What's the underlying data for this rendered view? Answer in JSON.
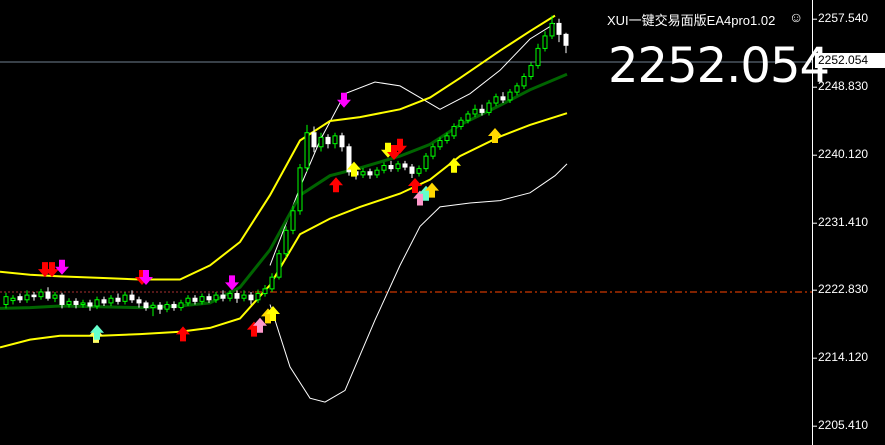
{
  "chart_data": {
    "type": "candlestick",
    "title": "XUI一键交易面版EA4pro1.02",
    "current_price": "2252.054",
    "current_price_tag": "2252.054",
    "y_ticks": [
      "2257.540",
      "2248.830",
      "2240.120",
      "2231.410",
      "2222.830",
      "2214.120",
      "2205.410"
    ],
    "ylim": [
      2203.0,
      2260.0
    ],
    "reference_level": 2222.6,
    "colors": {
      "background": "#000000",
      "bull_candle": "#00ff00",
      "bear_candle": "#ffffff",
      "outer_band": "#ffff00",
      "middle_line": "#006400",
      "envelope": "#ffffff",
      "reference_line": "#ff4500",
      "current_price_line": "#708090"
    },
    "upper_band": [
      [
        0,
        2225.2
      ],
      [
        30,
        2224.8
      ],
      [
        60,
        2224.6
      ],
      [
        100,
        2224.4
      ],
      [
        140,
        2224.2
      ],
      [
        180,
        2224.2
      ],
      [
        210,
        2226
      ],
      [
        240,
        2229
      ],
      [
        270,
        2235
      ],
      [
        300,
        2242
      ],
      [
        330,
        2244.5
      ],
      [
        360,
        2245
      ],
      [
        400,
        2246
      ],
      [
        430,
        2247.5
      ],
      [
        460,
        2250
      ],
      [
        500,
        2253.5
      ],
      [
        530,
        2256
      ],
      [
        555,
        2258
      ]
    ],
    "lower_band": [
      [
        0,
        2215.5
      ],
      [
        30,
        2216.5
      ],
      [
        60,
        2217
      ],
      [
        100,
        2217
      ],
      [
        140,
        2217.2
      ],
      [
        180,
        2217.5
      ],
      [
        210,
        2218
      ],
      [
        240,
        2219.2
      ],
      [
        270,
        2223.5
      ],
      [
        300,
        2230
      ],
      [
        330,
        2232
      ],
      [
        360,
        2233.5
      ],
      [
        400,
        2235.2
      ],
      [
        430,
        2237
      ],
      [
        460,
        2240
      ],
      [
        500,
        2242.5
      ],
      [
        530,
        2244
      ],
      [
        567,
        2245.5
      ]
    ],
    "middle_line": [
      [
        0,
        2220.5
      ],
      [
        30,
        2220.6
      ],
      [
        60,
        2220.8
      ],
      [
        100,
        2220.7
      ],
      [
        140,
        2220.6
      ],
      [
        180,
        2220.8
      ],
      [
        210,
        2221.2
      ],
      [
        240,
        2223.2
      ],
      [
        270,
        2228
      ],
      [
        300,
        2235
      ],
      [
        330,
        2237.5
      ],
      [
        360,
        2238.5
      ],
      [
        400,
        2240
      ],
      [
        430,
        2241.5
      ],
      [
        460,
        2244
      ],
      [
        500,
        2246.5
      ],
      [
        530,
        2248.5
      ],
      [
        567,
        2250.5
      ]
    ],
    "envelope_upper": [
      [
        270,
        2226
      ],
      [
        300,
        2236
      ],
      [
        320,
        2242
      ],
      [
        345,
        2248
      ],
      [
        375,
        2249.5
      ],
      [
        400,
        2249
      ],
      [
        420,
        2247.5
      ],
      [
        440,
        2246
      ],
      [
        470,
        2248
      ],
      [
        500,
        2251
      ],
      [
        530,
        2255
      ],
      [
        555,
        2257
      ]
    ],
    "envelope_lower": [
      [
        270,
        2221
      ],
      [
        290,
        2213
      ],
      [
        310,
        2209
      ],
      [
        325,
        2208.5
      ],
      [
        345,
        2210
      ],
      [
        375,
        2219
      ],
      [
        400,
        2226
      ],
      [
        420,
        2231
      ],
      [
        440,
        2233.5
      ],
      [
        470,
        2234
      ],
      [
        500,
        2234.3
      ],
      [
        530,
        2235.3
      ],
      [
        555,
        2237.5
      ],
      [
        567,
        2239
      ]
    ],
    "candles": [
      [
        6,
        2221,
        2222,
        2220.5,
        2222.5
      ],
      [
        13,
        2221.5,
        2221.8,
        2221,
        2222.2
      ],
      [
        20,
        2222,
        2221.6,
        2221.2,
        2222.4
      ],
      [
        27,
        2221.6,
        2222.2,
        2221.2,
        2222.8
      ],
      [
        34,
        2222.2,
        2222,
        2221.5,
        2222.6
      ],
      [
        41,
        2222,
        2222.6,
        2221.6,
        2223
      ],
      [
        48,
        2222.6,
        2221.8,
        2221.5,
        2223.2
      ],
      [
        55,
        2221.8,
        2222.2,
        2221.3,
        2222.6
      ],
      [
        62,
        2222.2,
        2221,
        2220.5,
        2222.5
      ],
      [
        69,
        2221,
        2221.4,
        2220.6,
        2221.8
      ],
      [
        76,
        2221.4,
        2221,
        2220.5,
        2221.8
      ],
      [
        83,
        2221,
        2221.2,
        2220.6,
        2221.6
      ],
      [
        90,
        2221.2,
        2220.8,
        2220.2,
        2221.6
      ],
      [
        97,
        2220.8,
        2221.6,
        2220.4,
        2222
      ],
      [
        104,
        2221.6,
        2221.2,
        2220.8,
        2222
      ],
      [
        111,
        2221.2,
        2221.8,
        2220.8,
        2222.2
      ],
      [
        118,
        2221.8,
        2221.4,
        2221,
        2222.4
      ],
      [
        125,
        2221.4,
        2222.2,
        2221,
        2222.6
      ],
      [
        132,
        2222.2,
        2221.6,
        2221.2,
        2222.8
      ],
      [
        139,
        2221.6,
        2221.2,
        2220.6,
        2222
      ],
      [
        146,
        2221.2,
        2220.6,
        2220.2,
        2221.5
      ],
      [
        153,
        2220.6,
        2220.9,
        2219.5,
        2221.3
      ],
      [
        160,
        2220.9,
        2220.4,
        2219.8,
        2221.3
      ],
      [
        167,
        2220.4,
        2221,
        2220,
        2221.4
      ],
      [
        174,
        2221,
        2220.6,
        2220.2,
        2221.4
      ],
      [
        181,
        2220.6,
        2221.2,
        2220.2,
        2221.6
      ],
      [
        188,
        2221.2,
        2221.8,
        2220.8,
        2222.2
      ],
      [
        195,
        2221.8,
        2221.4,
        2221,
        2222.2
      ],
      [
        202,
        2221.4,
        2222,
        2221,
        2222.4
      ],
      [
        209,
        2222,
        2221.6,
        2221.2,
        2222.4
      ],
      [
        216,
        2221.6,
        2222.2,
        2221.2,
        2222.6
      ],
      [
        223,
        2222.2,
        2221.8,
        2221.4,
        2222.8
      ],
      [
        230,
        2221.8,
        2222.4,
        2221.4,
        2222.8
      ],
      [
        237,
        2222.4,
        2221.8,
        2221.2,
        2222.8
      ],
      [
        244,
        2221.8,
        2222.2,
        2221.4,
        2222.8
      ],
      [
        251,
        2222.2,
        2221.6,
        2221,
        2222.6
      ],
      [
        258,
        2221.6,
        2222.4,
        2221.2,
        2222.9
      ],
      [
        265,
        2222.4,
        2223,
        2222,
        2223.5
      ],
      [
        272,
        2223,
        2224.5,
        2222.6,
        2225
      ],
      [
        279,
        2224.5,
        2227.5,
        2224.2,
        2228
      ],
      [
        286,
        2227.5,
        2230.5,
        2227,
        2231
      ],
      [
        293,
        2230.5,
        2233,
        2230,
        2233.6
      ],
      [
        300,
        2233,
        2238.5,
        2232.5,
        2239
      ],
      [
        307,
        2238.5,
        2243,
        2238,
        2244
      ],
      [
        314,
        2243,
        2241.2,
        2240.5,
        2243.8
      ],
      [
        321,
        2241.2,
        2242.4,
        2240.6,
        2243
      ],
      [
        328,
        2242.4,
        2241.6,
        2241,
        2242.8
      ],
      [
        335,
        2241.6,
        2242.6,
        2241,
        2243
      ],
      [
        342,
        2242.6,
        2241.2,
        2240.6,
        2243
      ],
      [
        349,
        2241.2,
        2238,
        2237.5,
        2241.6
      ],
      [
        356,
        2238,
        2237.6,
        2237,
        2238.4
      ],
      [
        363,
        2237.6,
        2238,
        2237.2,
        2238.5
      ],
      [
        370,
        2238,
        2237.6,
        2237.1,
        2238.4
      ],
      [
        377,
        2237.6,
        2238.2,
        2237.2,
        2238.6
      ],
      [
        384,
        2238.2,
        2238.8,
        2237.8,
        2239.2
      ],
      [
        391,
        2238.8,
        2238.4,
        2238,
        2239.4
      ],
      [
        398,
        2238.4,
        2239,
        2238,
        2239.4
      ],
      [
        405,
        2239,
        2238.6,
        2238.2,
        2239.4
      ],
      [
        412,
        2238.6,
        2237.8,
        2237.2,
        2239
      ],
      [
        419,
        2237.8,
        2238.4,
        2237.4,
        2238.8
      ],
      [
        426,
        2238.4,
        2240,
        2238,
        2240.4
      ],
      [
        433,
        2240,
        2241.2,
        2239.6,
        2241.6
      ],
      [
        440,
        2241.2,
        2242,
        2240.8,
        2242.4
      ],
      [
        447,
        2242,
        2242.6,
        2241.6,
        2243
      ],
      [
        454,
        2242.6,
        2243.8,
        2242.2,
        2244.2
      ],
      [
        461,
        2243.8,
        2244.6,
        2243.4,
        2245
      ],
      [
        468,
        2244.6,
        2245.4,
        2244.2,
        2245.8
      ],
      [
        475,
        2245.4,
        2246,
        2245,
        2246.6
      ],
      [
        482,
        2246,
        2245.6,
        2245.2,
        2246.6
      ],
      [
        489,
        2245.6,
        2246.8,
        2245.2,
        2247.2
      ],
      [
        496,
        2246.8,
        2247.6,
        2246.4,
        2248
      ],
      [
        503,
        2247.6,
        2247.2,
        2246.8,
        2248.2
      ],
      [
        510,
        2247.2,
        2248.2,
        2246.8,
        2248.6
      ],
      [
        517,
        2248.2,
        2249,
        2247.8,
        2249.4
      ],
      [
        524,
        2249,
        2250.2,
        2248.6,
        2250.6
      ],
      [
        531,
        2250.2,
        2251.6,
        2249.8,
        2252
      ],
      [
        538,
        2251.6,
        2253.8,
        2251.2,
        2254.4
      ],
      [
        545,
        2253.8,
        2255.4,
        2253.4,
        2256
      ],
      [
        552,
        2255.4,
        2257,
        2255,
        2258
      ],
      [
        559,
        2257,
        2255.6,
        2254.6,
        2257.6
      ],
      [
        566,
        2255.6,
        2254.2,
        2253.2,
        2255.8
      ]
    ],
    "arrows": [
      [
        45,
        2224.5,
        "down",
        "#ff0000"
      ],
      [
        52,
        2224.5,
        "down",
        "#ff0000"
      ],
      [
        62,
        2224.8,
        "down",
        "#ff00ff"
      ],
      [
        96,
        2218,
        "up",
        "#ffff66"
      ],
      [
        97,
        2218.4,
        "up",
        "#66ffcc"
      ],
      [
        142,
        2223.5,
        "down",
        "#ff0000"
      ],
      [
        146,
        2223.5,
        "down",
        "#ff00ff"
      ],
      [
        183,
        2218.2,
        "up",
        "#ff0000"
      ],
      [
        232,
        2222.8,
        "down",
        "#ff00ff"
      ],
      [
        254,
        2218.8,
        "up",
        "#ff0000"
      ],
      [
        260,
        2219.3,
        "up",
        "#ff99cc"
      ],
      [
        268,
        2220.5,
        "up",
        "#ffd700"
      ],
      [
        273,
        2220.8,
        "up",
        "#ffff00"
      ],
      [
        344,
        2246.2,
        "down",
        "#ff00ff"
      ],
      [
        336,
        2237.3,
        "up",
        "#ff0000"
      ],
      [
        354,
        2239.3,
        "up",
        "#ffff00"
      ],
      [
        388,
        2239.8,
        "down",
        "#ffff00"
      ],
      [
        394,
        2239.5,
        "down",
        "#ff0000"
      ],
      [
        400,
        2240.3,
        "down",
        "#ff0000"
      ],
      [
        415,
        2237.2,
        "up",
        "#ff0000"
      ],
      [
        420,
        2235.6,
        "up",
        "#ff99cc"
      ],
      [
        426,
        2236.2,
        "up",
        "#66ffcc"
      ],
      [
        432,
        2236.6,
        "up",
        "#ffd700"
      ],
      [
        454,
        2239.8,
        "up",
        "#ffff00"
      ],
      [
        495,
        2243.6,
        "up",
        "#ffd700"
      ]
    ]
  }
}
